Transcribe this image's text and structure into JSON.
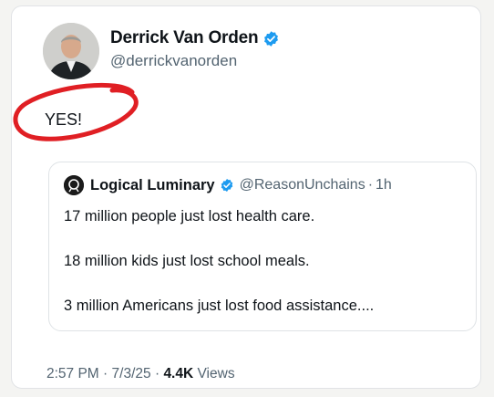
{
  "author": {
    "display_name": "Derrick Van Orden",
    "handle": "@derrickvanorden"
  },
  "tweet": {
    "text": "YES!",
    "time": "2:57 PM",
    "date": "7/3/25",
    "views_count": "4.4K",
    "views_label": "Views",
    "separator": "·"
  },
  "quoted": {
    "display_name": "Logical Luminary",
    "handle": "@ReasonUnchains",
    "separator": "·",
    "age": "1h",
    "lines": [
      "17 million people just lost health care.",
      "18 million kids just lost school meals.",
      "3 million Americans just lost food assistance...."
    ]
  },
  "colors": {
    "verified": "#1d9bf0",
    "annotation": "#e01f24",
    "muted_text": "#536471"
  },
  "icons": {
    "verified": "verified-badge-icon",
    "annotation": "red-circle-annotation"
  }
}
